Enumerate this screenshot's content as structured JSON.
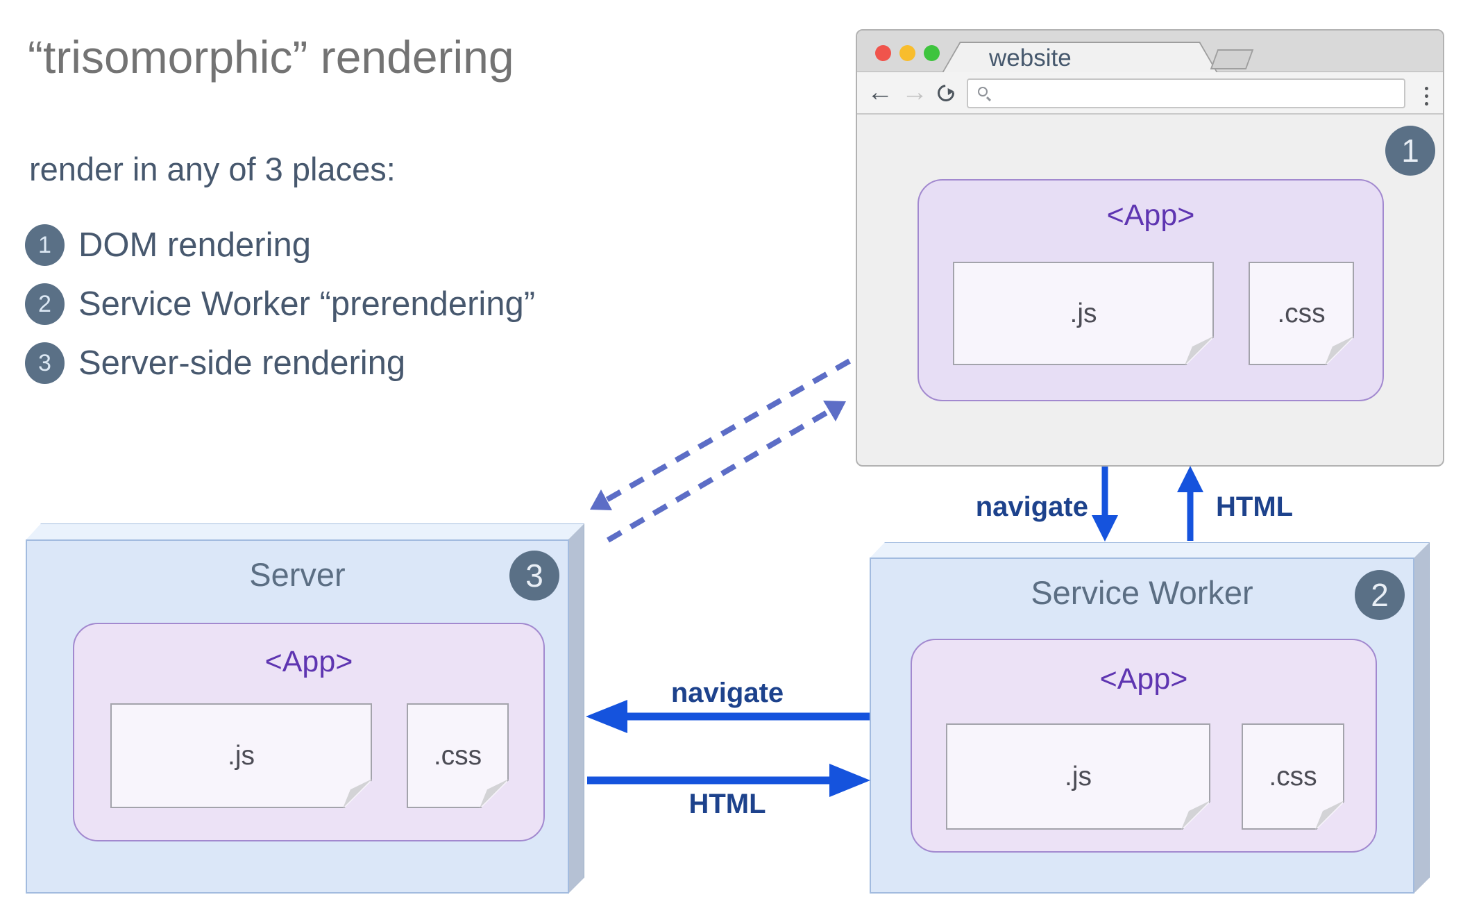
{
  "title": "“trisomorphic” rendering",
  "subtitle": "render in any of 3 places:",
  "legend": {
    "items": [
      {
        "num": "1",
        "label": "DOM rendering"
      },
      {
        "num": "2",
        "label": "Service Worker “prerendering”"
      },
      {
        "num": "3",
        "label": "Server-side rendering"
      }
    ]
  },
  "browser": {
    "tab_title": "website",
    "url_value": "",
    "url_placeholder": "",
    "step_badge": "1",
    "app_label": "<App>",
    "js_label": ".js",
    "css_label": ".css"
  },
  "server_box": {
    "title": "Server",
    "step_badge": "3",
    "app_label": "<App>",
    "js_label": ".js",
    "css_label": ".css"
  },
  "service_worker_box": {
    "title": "Service Worker",
    "step_badge": "2",
    "app_label": "<App>",
    "js_label": ".js",
    "css_label": ".css"
  },
  "arrows": {
    "browser_to_sw_label": "navigate",
    "sw_to_browser_label": "HTML",
    "sw_to_server_label": "navigate",
    "server_to_sw_label": "HTML"
  },
  "colors": {
    "arrow_blue": "#1553dd",
    "dashed_indigo": "#5c6dc6",
    "badge_slate": "#5a7086",
    "app_purple": "#5e35b1",
    "box_blue_front": "#dbe7f8",
    "lavender_app": "#e9dff5",
    "title_gray": "#737373",
    "body_slate": "#47586e"
  }
}
